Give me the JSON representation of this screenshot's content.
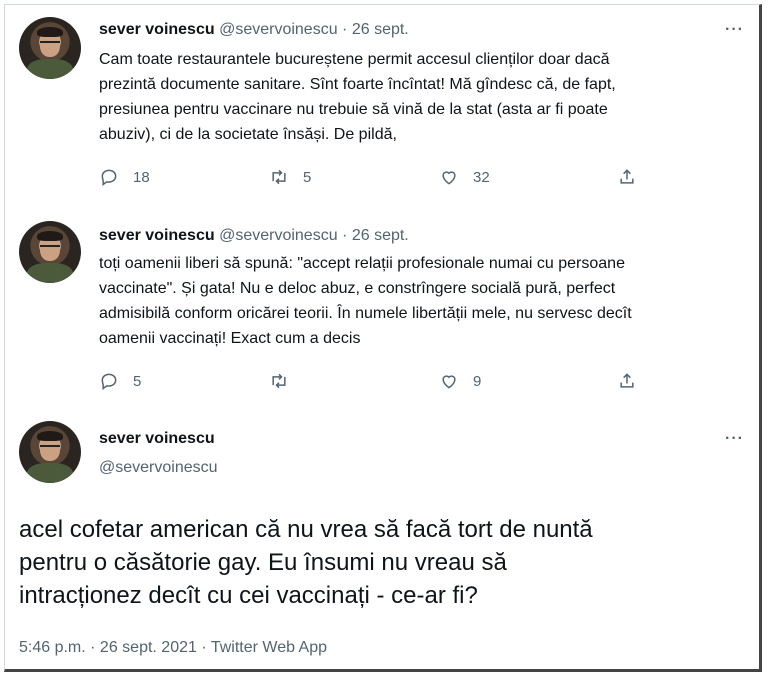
{
  "tweets": [
    {
      "name": "sever voinescu",
      "handle": "@severvoinescu",
      "date": "· 26 sept.",
      "lines": [
        "Cam toate restaurantele bucureștene permit accesul clienților doar dacă",
        "prezintă documente sanitare. Sînt foarte încîntat! Mă gîndesc că, de fapt,",
        "presiunea pentru vaccinare nu trebuie să vină de la stat (asta ar fi poate",
        "abuziv), ci de la societate însăși. De pildă,"
      ],
      "replies": "18",
      "retweets": "5",
      "likes": "32"
    },
    {
      "name": "sever voinescu",
      "handle": "@severvoinescu",
      "date": "· 26 sept.",
      "lines": [
        "toți oamenii liberi să spună: \"accept relații profesionale numai cu persoane",
        "vaccinate\". Și gata! Nu e deloc abuz, e constrîngere socială pură, perfect",
        "admisibilă conform oricărei teorii. În numele libertății mele, nu servesc decît",
        "oamenii vaccinați! Exact cum a decis"
      ],
      "replies": "5",
      "retweets": "",
      "likes": "9"
    }
  ],
  "main": {
    "name": "sever voinescu",
    "handle": "@severvoinescu",
    "lines": [
      "acel cofetar american că nu vrea să facă tort de nuntă",
      "pentru o căsătorie gay. Eu însumi nu vreau să",
      "intracționez decît cu cei vaccinați - ce-ar fi?"
    ],
    "timestamp": "5:46 p.m. · 26 sept. 2021 · Twitter Web App"
  },
  "icons": {
    "more": "more-icon",
    "reply": "reply-icon",
    "retweet": "retweet-icon",
    "like": "like-icon",
    "share": "share-icon"
  },
  "colors": {
    "text": "#0f1419",
    "muted": "#536471"
  }
}
